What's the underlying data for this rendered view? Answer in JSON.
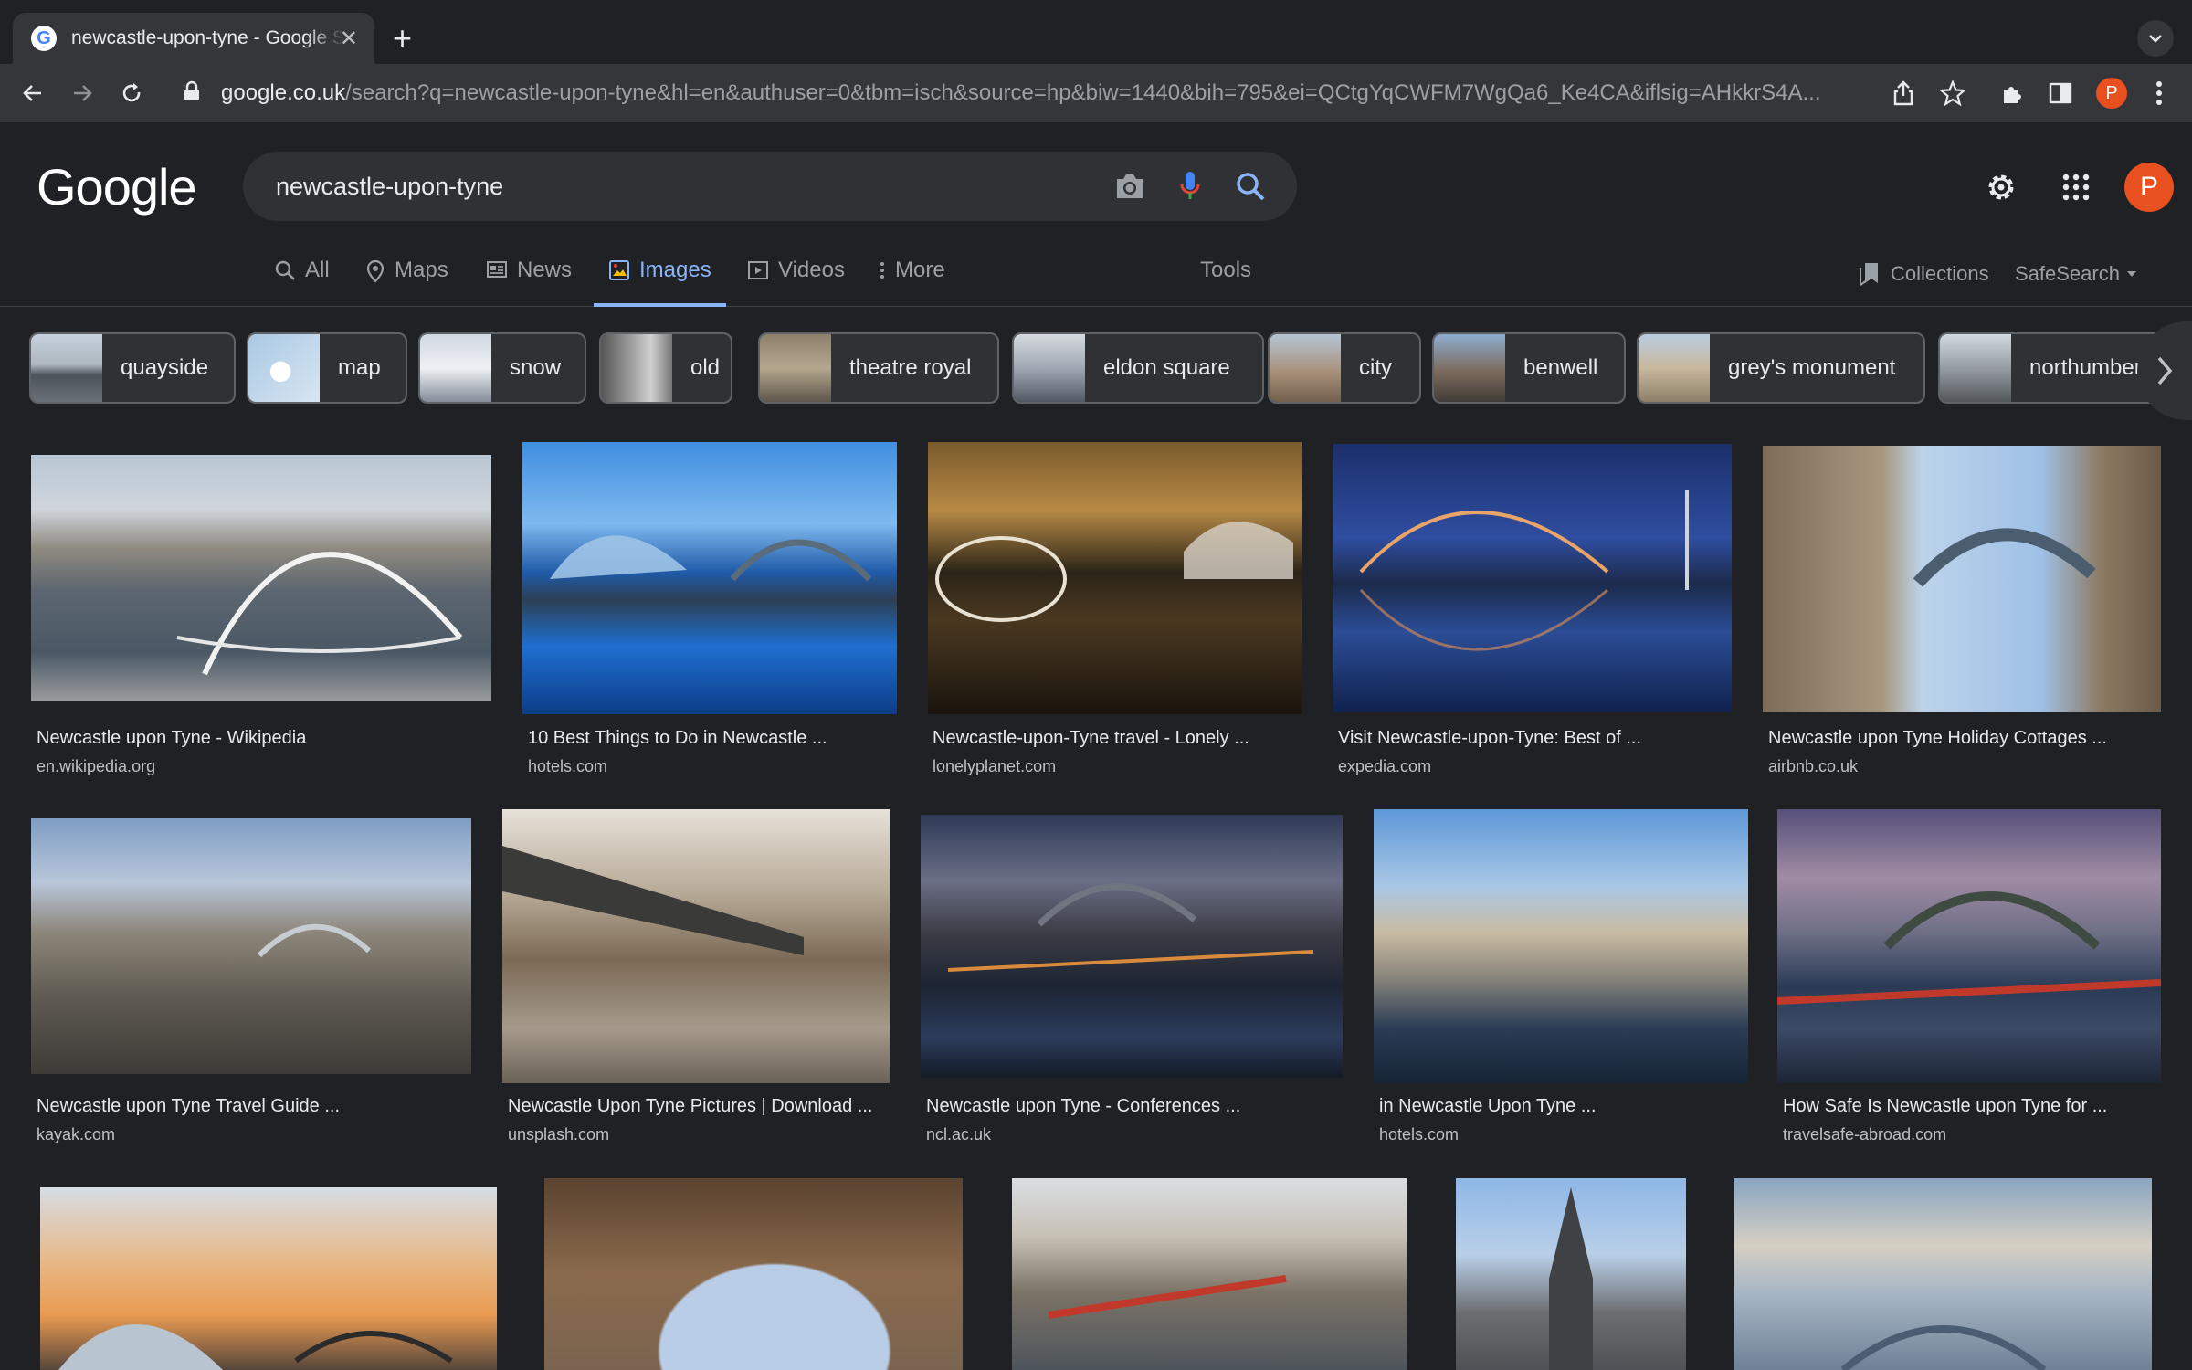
{
  "browser": {
    "tab_title": "newcastle-upon-tyne - Google Search",
    "url_host": "google.co.uk",
    "url_path": "/search?q=newcastle-upon-tyne&hl=en&authuser=0&tbm=isch&source=hp&biw=1440&bih=795&ei=QCtgYqCWFM7WgQa6_Ke4CA&iflsig=AHkkrS4A...",
    "profile_initial": "P"
  },
  "header": {
    "logo": "Google",
    "query": "newcastle-upon-tyne",
    "profile_initial": "P"
  },
  "nav": {
    "tabs": [
      {
        "label": "All"
      },
      {
        "label": "Maps"
      },
      {
        "label": "News"
      },
      {
        "label": "Images"
      },
      {
        "label": "Videos"
      },
      {
        "label": "More"
      }
    ],
    "tools": "Tools",
    "collections": "Collections",
    "safesearch": "SafeSearch"
  },
  "chips": [
    "quayside",
    "map",
    "snow",
    "old",
    "theatre royal",
    "eldon square",
    "city",
    "benwell",
    "grey's monument",
    "northumberland street"
  ],
  "results": [
    {
      "title": "Newcastle upon Tyne - Wikipedia",
      "source": "en.wikipedia.org"
    },
    {
      "title": "10 Best Things to Do in Newcastle ...",
      "source": "hotels.com"
    },
    {
      "title": "Newcastle-upon-Tyne travel - Lonely ...",
      "source": "lonelyplanet.com"
    },
    {
      "title": "Visit Newcastle-upon-Tyne: Best of ...",
      "source": "expedia.com"
    },
    {
      "title": "Newcastle upon Tyne Holiday Cottages ...",
      "source": "airbnb.co.uk"
    },
    {
      "title": "Newcastle upon Tyne Travel Guide ...",
      "source": "kayak.com"
    },
    {
      "title": "Newcastle Upon Tyne Pictures | Download ...",
      "source": "unsplash.com"
    },
    {
      "title": "Newcastle upon Tyne - Conferences ...",
      "source": "ncl.ac.uk"
    },
    {
      "title": "in Newcastle Upon Tyne ...",
      "source": "hotels.com"
    },
    {
      "title": "How Safe Is Newcastle upon Tyne for ...",
      "source": "travelsafe-abroad.com"
    }
  ],
  "colors": {
    "accent": "#8ab4f8",
    "background": "#202124",
    "profile": "#e8501f"
  }
}
